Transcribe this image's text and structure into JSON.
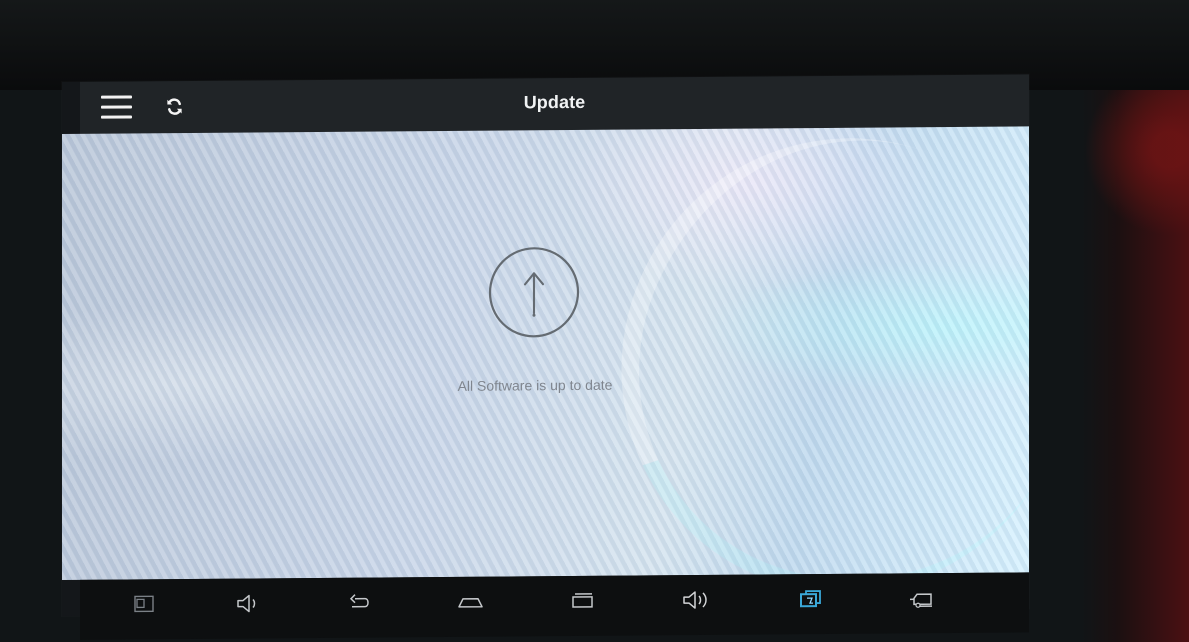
{
  "header": {
    "title": "Update"
  },
  "main": {
    "status_message": "All Software is up to date"
  },
  "icons": {
    "menu": "hamburger-menu-icon",
    "refresh": "refresh-icon",
    "update": "upload-arrow-icon",
    "navigation": [
      "screenshot-icon",
      "volume-down-icon",
      "back-icon",
      "home-icon",
      "recent-apps-icon",
      "volume-up-icon",
      "diagnostic-app-icon",
      "vehicle-icon"
    ]
  },
  "colors": {
    "title_bar": "#202427",
    "navigation_bar": "#0d0f10",
    "content_text": "#7f858e",
    "accent_icon": "#3aa8d9"
  }
}
